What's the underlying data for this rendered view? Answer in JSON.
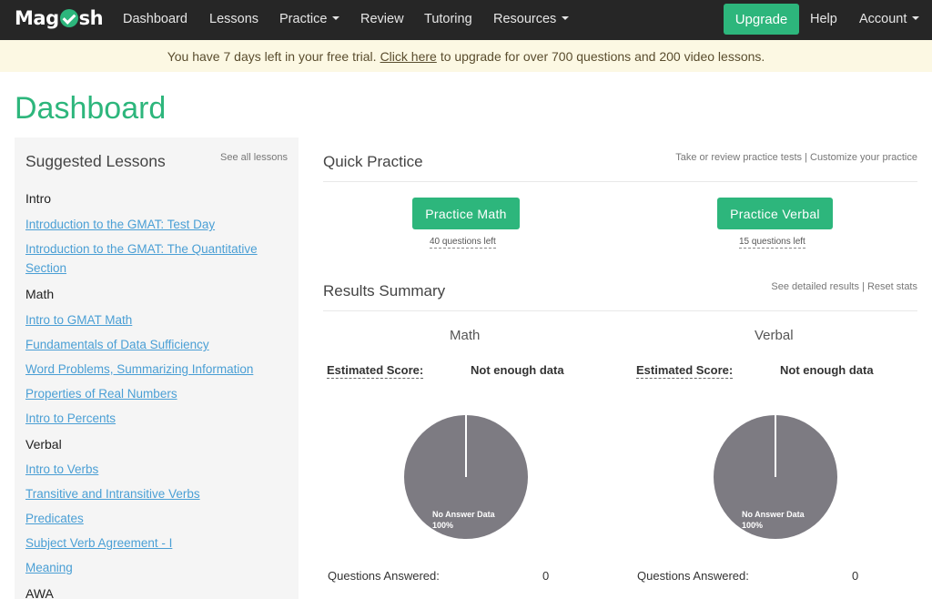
{
  "navbar": {
    "logo_left": "Mag",
    "logo_right": "sh",
    "items": [
      {
        "label": "Dashboard",
        "dropdown": false
      },
      {
        "label": "Lessons",
        "dropdown": false
      },
      {
        "label": "Practice",
        "dropdown": true
      },
      {
        "label": "Review",
        "dropdown": false
      },
      {
        "label": "Tutoring",
        "dropdown": false
      },
      {
        "label": "Resources",
        "dropdown": true
      }
    ],
    "upgrade": "Upgrade",
    "help": "Help",
    "account": "Account"
  },
  "banner": {
    "before": "You have 7 days left in your free trial.",
    "link": "Click here",
    "after": "to upgrade for over 700 questions and 200 video lessons."
  },
  "page_title": "Dashboard",
  "sidebar": {
    "title": "Suggested Lessons",
    "see_all": "See all lessons",
    "sections": [
      {
        "name": "Intro",
        "lessons": [
          "Introduction to the GMAT: Test Day",
          "Introduction to the GMAT: The Quantitative Section"
        ]
      },
      {
        "name": "Math",
        "lessons": [
          "Intro to GMAT Math",
          "Fundamentals of Data Sufficiency",
          "Word Problems, Summarizing Information",
          "Properties of Real Numbers",
          "Intro to Percents"
        ]
      },
      {
        "name": "Verbal",
        "lessons": [
          "Intro to Verbs",
          "Transitive and Intransitive Verbs",
          "Predicates",
          "Subject Verb Agreement - I",
          "Meaning"
        ]
      },
      {
        "name": "AWA",
        "lessons": []
      }
    ]
  },
  "quick_practice": {
    "title": "Quick Practice",
    "link1": "Take or review practice tests",
    "link2": "Customize your practice",
    "math_button": "Practice Math",
    "math_left": "40 questions left",
    "verbal_button": "Practice Verbal",
    "verbal_left": "15 questions left"
  },
  "results": {
    "title": "Results Summary",
    "link1": "See detailed results",
    "link2": "Reset stats",
    "columns": [
      {
        "name": "Math",
        "est_label": "Estimated Score:",
        "est_value": "Not enough data",
        "pie_label": "No Answer Data",
        "pie_percent": "100%",
        "qa_label": "Questions Answered:",
        "qa_value": "0"
      },
      {
        "name": "Verbal",
        "est_label": "Estimated Score:",
        "est_value": "Not enough data",
        "pie_label": "No Answer Data",
        "pie_percent": "100%",
        "qa_label": "Questions Answered:",
        "qa_value": "0"
      }
    ]
  },
  "colors": {
    "brand": "#2db67c",
    "navbar": "#262626",
    "banner": "#fcf8e3",
    "link": "#4a9fd5",
    "pie": "#7d7b82"
  }
}
